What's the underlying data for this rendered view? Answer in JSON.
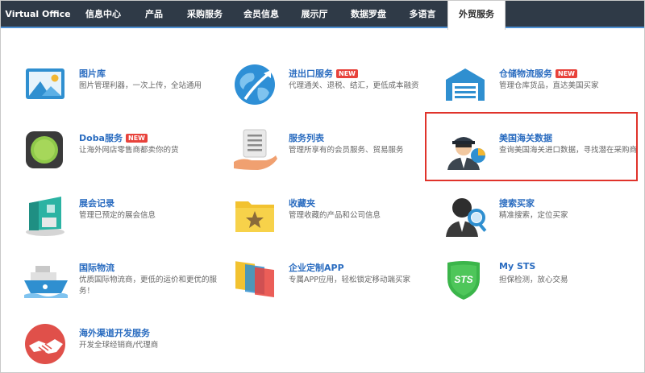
{
  "nav": {
    "items": [
      "Virtual Office",
      "信息中心",
      "产品",
      "采购服务",
      "会员信息",
      "展示厅",
      "数据罗盘",
      "多语言",
      "外贸服务"
    ],
    "active_index": 8
  },
  "services": [
    {
      "title": "图片库",
      "desc": "图片管理利器，一次上传，全站通用",
      "new": false,
      "icon": "picture-icon"
    },
    {
      "title": "进出口服务",
      "desc": "代理通关、退税、结汇，更低成本融资",
      "new": true,
      "icon": "globe-icon"
    },
    {
      "title": "仓储物流服务",
      "desc": "管理仓库货品，直达美国买家",
      "new": true,
      "icon": "warehouse-icon"
    },
    {
      "title": "Doba服务",
      "desc": "让海外网店零售商都卖你的货",
      "new": true,
      "icon": "doba-icon"
    },
    {
      "title": "服务列表",
      "desc": "管理所享有的会员服务、贸易服务",
      "new": false,
      "icon": "service-list-icon"
    },
    {
      "title": "美国海关数据",
      "desc": "查询美国海关进口数据，寻找潜在采购商",
      "new": false,
      "icon": "customs-officer-icon"
    },
    {
      "title": "展会记录",
      "desc": "管理已预定的展会信息",
      "new": false,
      "icon": "exhibition-booth-icon"
    },
    {
      "title": "收藏夹",
      "desc": "管理收藏的产品和公司信息",
      "new": false,
      "icon": "favorites-folder-icon"
    },
    {
      "title": "搜索买家",
      "desc": "精准搜索，定位买家",
      "new": false,
      "icon": "search-buyer-icon"
    },
    {
      "title": "国际物流",
      "desc": "优质国际物流商，更低的运价和更优的服务！",
      "new": false,
      "icon": "ship-icon"
    },
    {
      "title": "企业定制APP",
      "desc": "专属APP应用，轻松锁定移动端买家",
      "new": false,
      "icon": "app-icon"
    },
    {
      "title": "My STS",
      "desc": "担保检测，放心交易",
      "new": false,
      "icon": "sts-shield-icon"
    },
    {
      "title": "海外渠道开发服务",
      "desc": "开发全球经销商/代理商",
      "new": false,
      "icon": "handshake-icon"
    }
  ],
  "badge_text": "NEW",
  "colors": {
    "nav_bg": "#2f3a47",
    "link": "#2a6cc0",
    "badge": "#e8423b",
    "highlight": "#e0332b"
  }
}
